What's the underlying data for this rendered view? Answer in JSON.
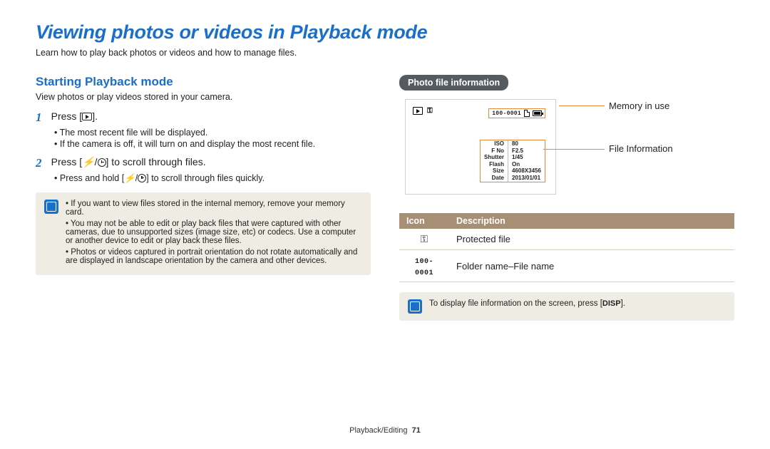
{
  "title": "Viewing photos or videos in Playback mode",
  "intro": "Learn how to play back photos or videos and how to manage files.",
  "left": {
    "heading": "Starting Playback mode",
    "sub": "View photos or play videos stored in your camera.",
    "step1_a": "Press [",
    "step1_b": "].",
    "step1_bullets": [
      "The most recent file will be displayed.",
      "If the camera is off, it will turn on and display the most recent file."
    ],
    "step2_a": "Press [",
    "step2_b": "/",
    "step2_c": "] to scroll through files.",
    "step2_bullet_a": "Press and hold [",
    "step2_bullet_b": "/",
    "step2_bullet_c": "] to scroll through files quickly.",
    "notes": [
      "If you want to view files stored in the internal memory, remove your memory card.",
      "You may not be able to edit or play back files that were captured with other cameras, due to unsupported sizes (image size, etc) or codecs. Use a computer or another device to edit or play back these files.",
      "Photos or videos captured in portrait orientation do not rotate automatically and are displayed in landscape orientation by the camera and other devices."
    ]
  },
  "right": {
    "pill": "Photo file information",
    "callout1": "Memory in use",
    "callout2": "File Information",
    "lcd": {
      "file_code": "100-0001",
      "info": {
        "ISO": "80",
        "F No": "F2.5",
        "Shutter": "1/45",
        "Flash": "On",
        "Size": "4608X3456",
        "Date": "2013/01/01"
      }
    },
    "table": {
      "h1": "Icon",
      "h2": "Description",
      "rows": [
        {
          "icon": "key",
          "desc": "Protected file"
        },
        {
          "icon": "filecode",
          "desc": "Folder name–File name"
        }
      ]
    },
    "tip_a": "To display file information on the screen, press [",
    "tip_btn": "DISP",
    "tip_b": "]."
  },
  "footer": {
    "section": "Playback/Editing",
    "page": "71"
  }
}
